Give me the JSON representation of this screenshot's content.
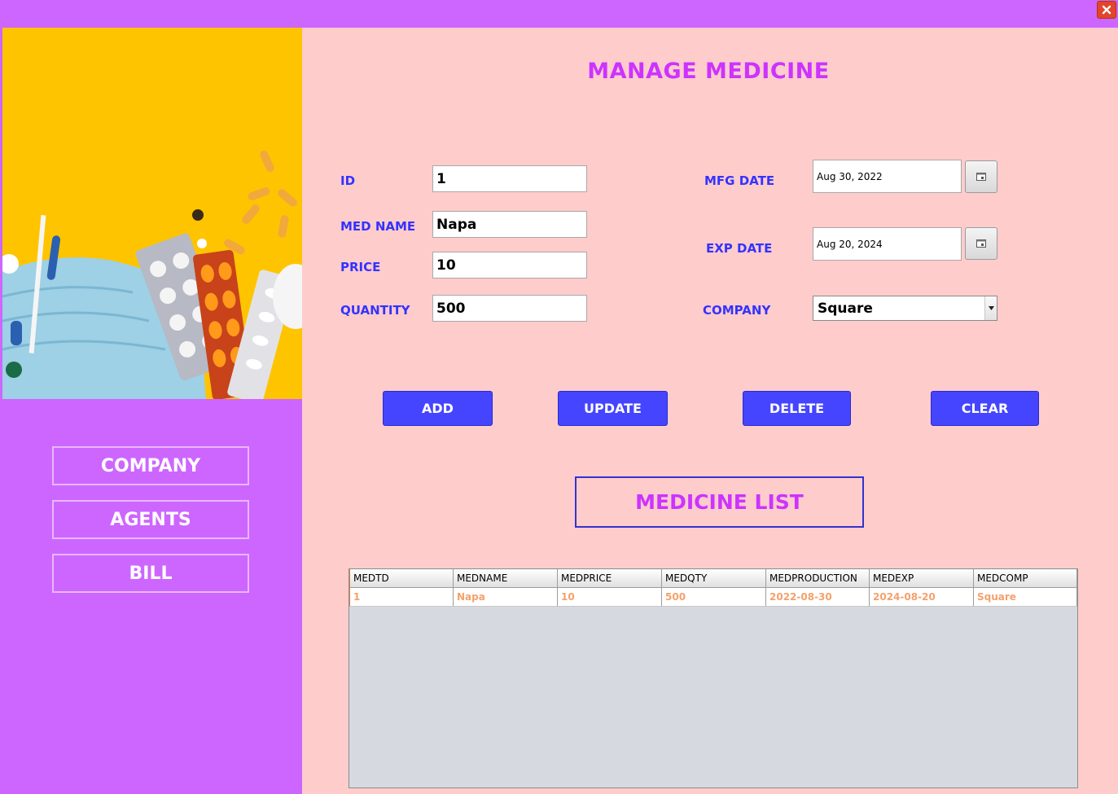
{
  "window": {
    "close_icon": "close-icon",
    "accent": "#cd66ff"
  },
  "sidebar": {
    "items": [
      {
        "label": "COMPANY"
      },
      {
        "label": "AGENTS"
      },
      {
        "label": "BILL"
      }
    ]
  },
  "main": {
    "title": "MANAGE MEDICINE",
    "form": {
      "id_label": "ID",
      "id_value": "1",
      "name_label": "MED NAME",
      "name_value": "Napa",
      "price_label": "PRICE",
      "price_value": "10",
      "qty_label": "QUANTITY",
      "qty_value": "500",
      "mfg_label": "MFG DATE",
      "mfg_value": "Aug 30, 2022",
      "exp_label": "EXP DATE",
      "exp_value": "Aug 20, 2024",
      "company_label": "COMPANY",
      "company_value": "Square"
    },
    "buttons": {
      "add": "ADD",
      "update": "UPDATE",
      "delete": "DELETE",
      "clear": "CLEAR"
    },
    "list_title": "MEDICINE LIST",
    "table": {
      "columns": [
        "MEDTD",
        "MEDNAME",
        "MEDPRICE",
        "MEDQTY",
        "MEDPRODUCTION",
        "MEDEXP",
        "MEDCOMP"
      ],
      "rows": [
        [
          "1",
          "Napa",
          "10",
          "500",
          "2022-08-30",
          "2024-08-20",
          "Square"
        ]
      ]
    }
  }
}
